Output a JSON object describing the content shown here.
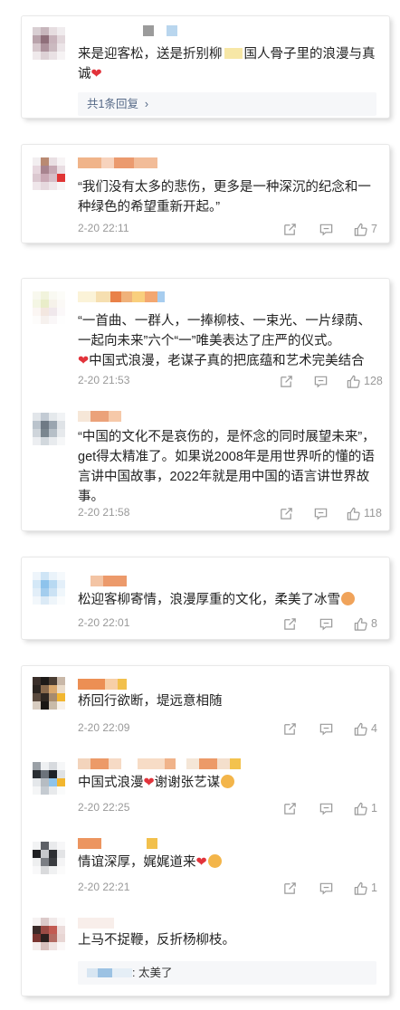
{
  "comments": [
    {
      "text": "来是迎客松，送是折别柳",
      "text2": "国人骨子里的浪漫与真诚",
      "replies_link": "共1条回复",
      "replies_arrow": "›"
    },
    {
      "text": "“我们没有太多的悲伤，更多是一种深沉的纪念和一种绿色的希望重新开起。”",
      "time": "2-20 22:11",
      "likes": "7"
    },
    {
      "text": "“一首曲、一群人，一捧柳枝、一束光、一片绿荫、一起向未来”六个“一”唯美表达了庄严的仪式。",
      "text2": "中国式浪漫，老谋子真的把底蕴和艺术完美结合",
      "time": "2-20 21:53",
      "likes": "128"
    },
    {
      "text": "“中国的文化不是哀伤的，是怀念的同时展望未来”，get得太精准了。如果说2008年是用世界听的懂的语言讲中国故事，2022年就是用中国的语言讲世界故事。",
      "time": "2-20 21:58",
      "likes": "118"
    },
    {
      "text": "松迎客柳寄情，浪漫厚重的文化，柔美了冰雪",
      "time": "2-20 22:01",
      "likes": "8"
    },
    {
      "text": "桥回行欲断，堤远意相随",
      "time": "2-20 22:09",
      "likes": "4"
    },
    {
      "text": "中国式浪漫",
      "text2": "谢谢张艺谋",
      "time": "2-20 22:25",
      "likes": "1"
    },
    {
      "text": "情谊深厚，娓娓道来",
      "time": "2-20 22:21",
      "likes": "1"
    },
    {
      "text": "上马不捉鞭，反折杨柳枝。",
      "reply_preview": "太美了"
    }
  ],
  "icons": {
    "share": "share-icon",
    "comment": "comment-icon",
    "like": "thumbs-up-icon",
    "heart": "heart-icon"
  },
  "colors": {
    "heart": "#e2333b",
    "link": "#556987",
    "meta": "#999999"
  }
}
